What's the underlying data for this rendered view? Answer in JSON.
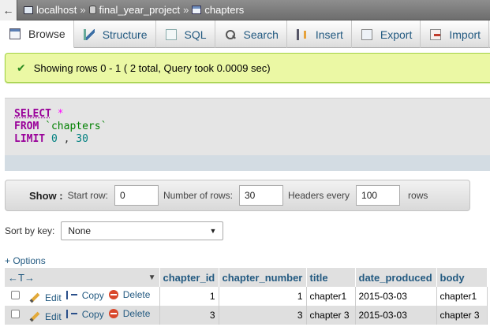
{
  "breadcrumb": {
    "back_icon": "arrow-left-icon",
    "server": "localhost",
    "database": "final_year_project",
    "table": "chapters",
    "separator": "»"
  },
  "tabs": [
    {
      "label": "Browse",
      "icon": "browse-icon",
      "active": true
    },
    {
      "label": "Structure",
      "icon": "structure-icon"
    },
    {
      "label": "SQL",
      "icon": "sql-icon"
    },
    {
      "label": "Search",
      "icon": "search-icon"
    },
    {
      "label": "Insert",
      "icon": "insert-icon"
    },
    {
      "label": "Export",
      "icon": "export-icon"
    },
    {
      "label": "Import",
      "icon": "import-icon"
    }
  ],
  "message": {
    "text": "Showing rows 0 - 1 ( 2 total, Query took 0.0009 sec)",
    "icon": "check-icon",
    "color": "#ebf8a4"
  },
  "sql": {
    "select_kw": "SELECT",
    "star": "*",
    "from_kw": "FROM",
    "table": "`chapters`",
    "limit_kw": "LIMIT",
    "offset": "0",
    "comma": ",",
    "count": "30"
  },
  "navigation": {
    "show_label": "Show :",
    "start_row_label": "Start row:",
    "start_row_value": "0",
    "rows_label": "Number of rows:",
    "rows_value": "30",
    "headers_label": "Headers every",
    "headers_value": "100",
    "rows_suffix": "rows"
  },
  "sort": {
    "label": "Sort by key:",
    "selected": "None"
  },
  "options_link": "+ Options",
  "table": {
    "columns": [
      "chapter_id",
      "chapter_number",
      "title",
      "date_produced",
      "body"
    ],
    "actions": {
      "edit": "Edit",
      "copy": "Copy",
      "delete": "Delete"
    },
    "rows": [
      [
        "1",
        "1",
        "chapter1",
        "2015-03-03",
        "chapter1"
      ],
      [
        "3",
        "3",
        "chapter 3",
        "2015-03-03",
        "chapter 3"
      ]
    ]
  }
}
